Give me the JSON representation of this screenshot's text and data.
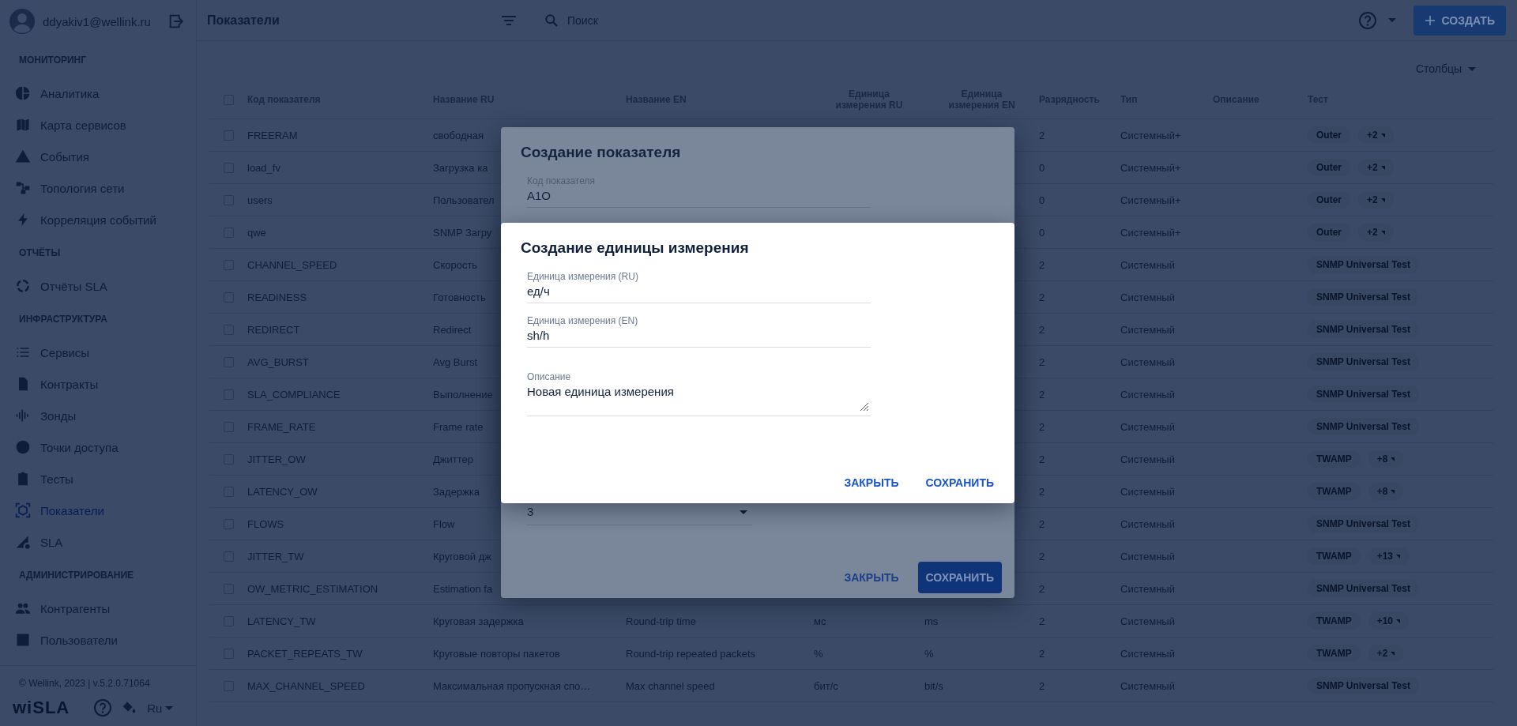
{
  "user": {
    "email": "ddyakiv1@wellink.ru"
  },
  "sidebar": {
    "sections": [
      {
        "title": "МОНИТОРИНГ",
        "items": [
          {
            "label": "Аналитика",
            "selected": false
          },
          {
            "label": "Карта сервисов",
            "selected": false
          },
          {
            "label": "События",
            "selected": false
          },
          {
            "label": "Топология сети",
            "selected": false
          },
          {
            "label": "Корреляция событий",
            "selected": false
          }
        ]
      },
      {
        "title": "ОТЧЁТЫ",
        "items": [
          {
            "label": "Отчёты SLA",
            "selected": false
          }
        ]
      },
      {
        "title": "ИНФРАСТРУКТУРА",
        "items": [
          {
            "label": "Сервисы",
            "selected": false
          },
          {
            "label": "Контракты",
            "selected": false
          },
          {
            "label": "Зонды",
            "selected": false
          },
          {
            "label": "Точки доступа",
            "selected": false
          },
          {
            "label": "Тесты",
            "selected": false
          },
          {
            "label": "Показатели",
            "selected": true
          },
          {
            "label": "SLA",
            "selected": false
          }
        ]
      },
      {
        "title": "АДМИНИСТРИРОВАНИЕ",
        "items": [
          {
            "label": "Контрагенты",
            "selected": false
          },
          {
            "label": "Пользователи",
            "selected": false
          }
        ]
      }
    ]
  },
  "footer": {
    "copyright": "© Wellink, 2023 | v.5.2.0.71064",
    "logo": "wiSLA",
    "language": "Ru"
  },
  "topbar": {
    "title": "Показатели",
    "search": {
      "placeholder": "Поиск"
    },
    "create_button": "СОЗДАТЬ"
  },
  "columns_button": "Столбцы",
  "table": {
    "all_checked": false,
    "columns": [
      "Код показателя",
      "Название RU",
      "Название EN",
      "Единица измерения RU",
      "Единица измерения EN",
      "Разрядность",
      "Тип",
      "Описание",
      "Тест"
    ],
    "rows": [
      {
        "checked": false,
        "code": "FREERAM",
        "name_ru": "свободная",
        "digits": "2",
        "type": "Системный+",
        "tests": [
          {
            "kind": "tag",
            "label": "Outer"
          },
          {
            "kind": "more",
            "label": "+2"
          }
        ]
      },
      {
        "checked": false,
        "code": "load_fv",
        "name_ru": "Загрузка ка",
        "digits": "0",
        "type": "Системный+",
        "tests": [
          {
            "kind": "tag",
            "label": "Outer"
          },
          {
            "kind": "more",
            "label": "+2"
          }
        ]
      },
      {
        "checked": false,
        "code": "users",
        "name_ru": "Пользовател",
        "digits": "0",
        "type": "Системный+",
        "tests": [
          {
            "kind": "tag",
            "label": "Outer"
          },
          {
            "kind": "more",
            "label": "+2"
          }
        ]
      },
      {
        "checked": false,
        "code": "qwe",
        "name_ru": "SNMP Загру",
        "digits": "0",
        "type": "Системный+",
        "tests": [
          {
            "kind": "tag",
            "label": "Outer"
          },
          {
            "kind": "more",
            "label": "+2"
          }
        ]
      },
      {
        "checked": false,
        "code": "CHANNEL_SPEED",
        "name_ru": "Скорость",
        "digits": "2",
        "type": "Системный",
        "tests": [
          {
            "kind": "tag",
            "label": "SNMP Universal Test"
          }
        ]
      },
      {
        "checked": false,
        "code": "READINESS",
        "name_ru": "Готовность",
        "digits": "2",
        "type": "Системный",
        "tests": [
          {
            "kind": "tag",
            "label": "SNMP Universal Test"
          }
        ]
      },
      {
        "checked": false,
        "code": "REDIRECT",
        "name_ru": "Redirect",
        "digits": "2",
        "type": "Системный",
        "tests": [
          {
            "kind": "tag",
            "label": "SNMP Universal Test"
          }
        ]
      },
      {
        "checked": false,
        "code": "AVG_BURST",
        "name_ru": "Avg Burst",
        "digits": "2",
        "type": "Системный",
        "tests": [
          {
            "kind": "tag",
            "label": "SNMP Universal Test"
          }
        ]
      },
      {
        "checked": false,
        "code": "SLA_COMPLIANCE",
        "name_ru": "Выполнение",
        "digits": "2",
        "type": "Системный",
        "tests": [
          {
            "kind": "tag",
            "label": "SNMP Universal Test"
          }
        ]
      },
      {
        "checked": false,
        "code": "FRAME_RATE",
        "name_ru": "Frame rate",
        "digits": "2",
        "type": "Системный",
        "tests": [
          {
            "kind": "tag",
            "label": "SNMP Universal Test"
          }
        ]
      },
      {
        "checked": false,
        "code": "JITTER_OW",
        "name_ru": "Джиттер",
        "digits": "2",
        "type": "Системный",
        "tests": [
          {
            "kind": "tag",
            "label": "TWAMP"
          },
          {
            "kind": "more",
            "label": "+8"
          }
        ]
      },
      {
        "checked": false,
        "code": "LATENCY_OW",
        "name_ru": "Задержка",
        "digits": "2",
        "type": "Системный",
        "tests": [
          {
            "kind": "tag",
            "label": "TWAMP"
          },
          {
            "kind": "more",
            "label": "+8"
          }
        ]
      },
      {
        "checked": false,
        "code": "FLOWS",
        "name_ru": "Flow",
        "digits": "2",
        "type": "Системный",
        "tests": [
          {
            "kind": "tag",
            "label": "SNMP Universal Test"
          }
        ]
      },
      {
        "checked": false,
        "code": "JITTER_TW",
        "name_ru": "Круговой дж",
        "digits": "2",
        "type": "Системный",
        "tests": [
          {
            "kind": "tag",
            "label": "TWAMP"
          },
          {
            "kind": "more",
            "label": "+13"
          }
        ]
      },
      {
        "checked": false,
        "code": "OW_METRIC_ESTIMATION",
        "name_ru": "Estimation fa",
        "digits": "2",
        "type": "Системный",
        "tests": [
          {
            "kind": "tag",
            "label": "SNMP Universal Test"
          }
        ]
      },
      {
        "checked": false,
        "code": "LATENCY_TW",
        "name_ru": "Круговая задержка",
        "name_en": "Round-trip time",
        "unit_ru": "мс",
        "unit_en": "ms",
        "digits": "2",
        "type": "Системный",
        "tests": [
          {
            "kind": "tag",
            "label": "TWAMP"
          },
          {
            "kind": "more",
            "label": "+10"
          }
        ]
      },
      {
        "checked": false,
        "code": "PACKET_REPEATS_TW",
        "name_ru": "Круговые повторы пакетов",
        "name_en": "Round-trip repeated packets",
        "unit_ru": "%",
        "unit_en": "%",
        "digits": "2",
        "type": "Системный",
        "tests": [
          {
            "kind": "tag",
            "label": "TWAMP"
          },
          {
            "kind": "more",
            "label": "+2"
          }
        ]
      },
      {
        "checked": false,
        "code": "MAX_CHANNEL_SPEED",
        "name_ru": "Максимальная пропускная спо…",
        "name_en": "Max channel speed",
        "unit_ru": "бит/с",
        "unit_en": "bit/s",
        "digits": "2",
        "type": "Системный",
        "tests": [
          {
            "kind": "tag",
            "label": "SNMP Universal Test"
          }
        ]
      }
    ]
  },
  "dialogs": [
    {
      "title": "Создание показателя",
      "fields": [
        {
          "kind": "text",
          "label": "Код показателя",
          "value": "A1O"
        },
        {
          "kind": "select",
          "value": "3"
        }
      ],
      "buttons": [
        {
          "kind": "text",
          "label": "ЗАКРЫТЬ"
        },
        {
          "kind": "filled",
          "label": "СОХРАНИТЬ"
        }
      ]
    },
    {
      "title": "Создание единицы измерения",
      "fields": [
        {
          "kind": "text",
          "label": "Единица измерения (RU)",
          "value": "ед/ч"
        },
        {
          "kind": "text",
          "label": "Единица измерения (EN)",
          "value": "sh/h"
        },
        {
          "kind": "textarea",
          "label": "Описание",
          "value": "Новая единица измерения"
        }
      ],
      "buttons": [
        {
          "kind": "text",
          "label": "ЗАКРЫТЬ"
        },
        {
          "kind": "text",
          "label": "СОХРАНИТЬ"
        }
      ]
    }
  ]
}
